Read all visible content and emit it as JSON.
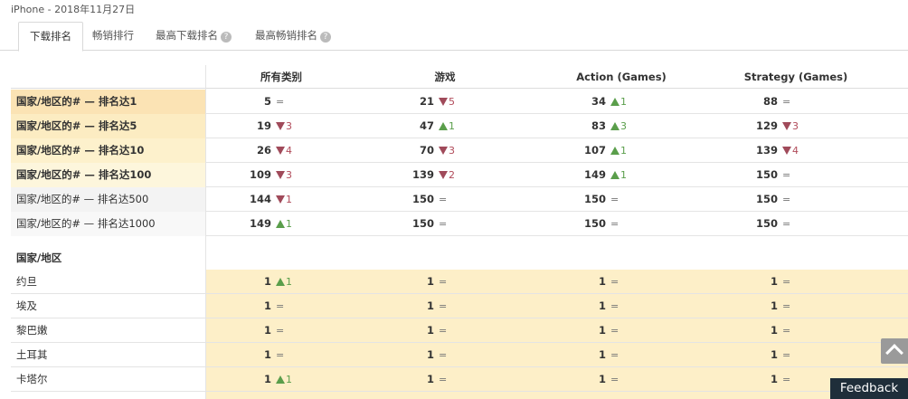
{
  "header": {
    "title": "iPhone - 2018年11月27日"
  },
  "tabs": [
    {
      "label": "下载排名",
      "help": false
    },
    {
      "label": "畅销排行",
      "help": false
    },
    {
      "label": "最高下载排名",
      "help": true
    },
    {
      "label": "最高畅销排名",
      "help": true
    }
  ],
  "help_icon": "question-circle-icon",
  "columns": [
    "所有类别",
    "游戏",
    "Action (Games)",
    "Strategy (Games)"
  ],
  "summary_rows": [
    {
      "label": "国家/地区的# — 排名达1",
      "bg": "#fbe3b4",
      "cells": [
        {
          "num": "5",
          "dir": "eq",
          "delta": ""
        },
        {
          "num": "21",
          "dir": "down",
          "delta": "5"
        },
        {
          "num": "34",
          "dir": "up",
          "delta": "1"
        },
        {
          "num": "88",
          "dir": "eq",
          "delta": ""
        }
      ]
    },
    {
      "label": "国家/地区的# — 排名达5",
      "bg": "#fcecc2",
      "cells": [
        {
          "num": "19",
          "dir": "down",
          "delta": "3"
        },
        {
          "num": "47",
          "dir": "up",
          "delta": "1"
        },
        {
          "num": "83",
          "dir": "up",
          "delta": "3"
        },
        {
          "num": "129",
          "dir": "down",
          "delta": "3"
        }
      ]
    },
    {
      "label": "国家/地区的# — 排名达10",
      "bg": "#fdf1cc",
      "cells": [
        {
          "num": "26",
          "dir": "down",
          "delta": "4"
        },
        {
          "num": "70",
          "dir": "down",
          "delta": "3"
        },
        {
          "num": "107",
          "dir": "up",
          "delta": "1"
        },
        {
          "num": "139",
          "dir": "down",
          "delta": "4"
        }
      ]
    },
    {
      "label": "国家/地区的# — 排名达100",
      "bg": "#fdf6dc",
      "cells": [
        {
          "num": "109",
          "dir": "down",
          "delta": "3"
        },
        {
          "num": "139",
          "dir": "down",
          "delta": "2"
        },
        {
          "num": "149",
          "dir": "up",
          "delta": "1"
        },
        {
          "num": "150",
          "dir": "eq",
          "delta": ""
        }
      ]
    },
    {
      "label": "国家/地区的# — 排名达500",
      "bg": "#f3f3f3",
      "cells": [
        {
          "num": "144",
          "dir": "down",
          "delta": "1"
        },
        {
          "num": "150",
          "dir": "eq",
          "delta": ""
        },
        {
          "num": "150",
          "dir": "eq",
          "delta": ""
        },
        {
          "num": "150",
          "dir": "eq",
          "delta": ""
        }
      ]
    },
    {
      "label": "国家/地区的# — 排名达1000",
      "bg": "#f8f8f8",
      "cells": [
        {
          "num": "149",
          "dir": "up",
          "delta": "1"
        },
        {
          "num": "150",
          "dir": "eq",
          "delta": ""
        },
        {
          "num": "150",
          "dir": "eq",
          "delta": ""
        },
        {
          "num": "150",
          "dir": "eq",
          "delta": ""
        }
      ]
    }
  ],
  "country_section": {
    "label": "国家/地区"
  },
  "country_rows": [
    {
      "label": "约旦",
      "cells": [
        {
          "num": "1",
          "dir": "up",
          "delta": "1"
        },
        {
          "num": "1",
          "dir": "eq",
          "delta": ""
        },
        {
          "num": "1",
          "dir": "eq",
          "delta": ""
        },
        {
          "num": "1",
          "dir": "eq",
          "delta": ""
        }
      ]
    },
    {
      "label": "埃及",
      "cells": [
        {
          "num": "1",
          "dir": "eq",
          "delta": ""
        },
        {
          "num": "1",
          "dir": "eq",
          "delta": ""
        },
        {
          "num": "1",
          "dir": "eq",
          "delta": ""
        },
        {
          "num": "1",
          "dir": "eq",
          "delta": ""
        }
      ]
    },
    {
      "label": "黎巴嫩",
      "cells": [
        {
          "num": "1",
          "dir": "eq",
          "delta": ""
        },
        {
          "num": "1",
          "dir": "eq",
          "delta": ""
        },
        {
          "num": "1",
          "dir": "eq",
          "delta": ""
        },
        {
          "num": "1",
          "dir": "eq",
          "delta": ""
        }
      ]
    },
    {
      "label": "土耳其",
      "cells": [
        {
          "num": "1",
          "dir": "eq",
          "delta": ""
        },
        {
          "num": "1",
          "dir": "eq",
          "delta": ""
        },
        {
          "num": "1",
          "dir": "eq",
          "delta": ""
        },
        {
          "num": "1",
          "dir": "eq",
          "delta": ""
        }
      ]
    },
    {
      "label": "卡塔尔",
      "cells": [
        {
          "num": "1",
          "dir": "up",
          "delta": "1"
        },
        {
          "num": "1",
          "dir": "eq",
          "delta": ""
        },
        {
          "num": "1",
          "dir": "eq",
          "delta": ""
        },
        {
          "num": "1",
          "dir": "eq",
          "delta": ""
        }
      ]
    }
  ],
  "country_cell_bg": "#fdefc8",
  "colors": {
    "up": "#5a9e4b",
    "down": "#b14b5a"
  },
  "scroll_top_icon": "chevron-up-icon",
  "feedback": {
    "label": "Feedback"
  }
}
